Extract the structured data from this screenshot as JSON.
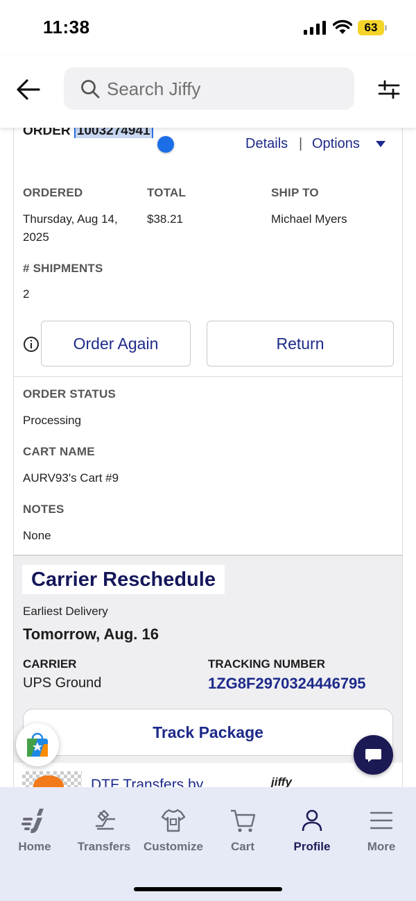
{
  "status_bar": {
    "time": "11:38",
    "battery": "63"
  },
  "header": {
    "search_placeholder": "Search Jiffy"
  },
  "order": {
    "heading_prefix": "ORDER",
    "number": "1003274941",
    "details_link": "Details",
    "separator": "|",
    "options_link": "Options",
    "ordered_label": "ORDERED",
    "ordered_value": "Thursday, Aug 14, 2025",
    "total_label": "TOTAL",
    "total_value": "$38.21",
    "ship_to_label": "SHIP TO",
    "ship_to_value": "Michael Myers",
    "shipments_label": "# SHIPMENTS",
    "shipments_value": "2",
    "order_again_button": "Order Again",
    "return_button": "Return",
    "status_label": "ORDER STATUS",
    "status_value": "Processing",
    "cart_name_label": "CART NAME",
    "cart_name_value": "AURV93's Cart #9",
    "notes_label": "NOTES",
    "notes_value": "None"
  },
  "shipment": {
    "title": "Carrier Reschedule",
    "earliest_label": "Earliest Delivery",
    "earliest_date": "Tomorrow, Aug. 16",
    "carrier_label": "CARRIER",
    "carrier_value": "UPS Ground",
    "tracking_label": "TRACKING NUMBER",
    "tracking_value": "1ZG8F2970324446795",
    "track_button": "Track Package",
    "product_title": "DTF Transfers by",
    "product_brand": "jiffy"
  },
  "tab_bar": {
    "tabs": [
      {
        "label": "Home",
        "icon": "jiffy-logo-icon",
        "active": false
      },
      {
        "label": "Transfers",
        "icon": "transfers-icon",
        "active": false
      },
      {
        "label": "Customize",
        "icon": "shirt-icon",
        "active": false
      },
      {
        "label": "Cart",
        "icon": "cart-icon",
        "active": false
      },
      {
        "label": "Profile",
        "icon": "profile-icon",
        "active": true
      },
      {
        "label": "More",
        "icon": "menu-icon",
        "active": false
      }
    ]
  },
  "colors": {
    "accent": "#1d2a8a",
    "dark_navy": "#1c1a55",
    "tab_bar_bg": "#e6e9f6",
    "selection_highlight": "#c8d8f2",
    "battery": "#f5d42a"
  }
}
